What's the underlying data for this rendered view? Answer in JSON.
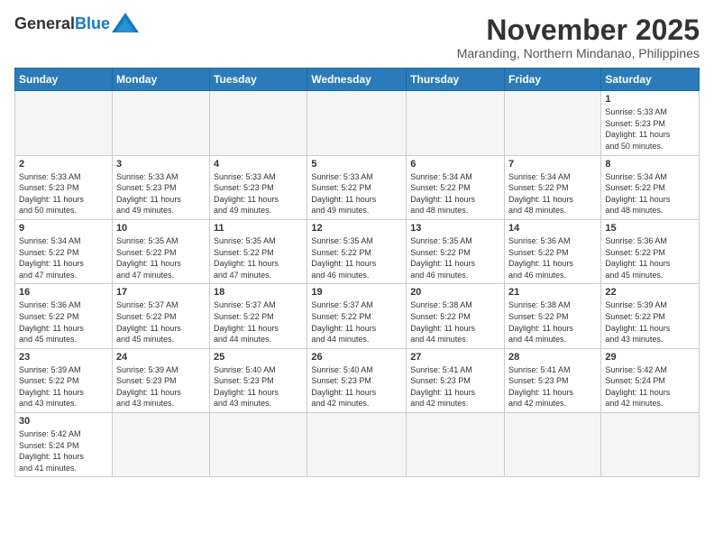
{
  "header": {
    "logo_general": "General",
    "logo_blue": "Blue",
    "month_title": "November 2025",
    "location": "Maranding, Northern Mindanao, Philippines"
  },
  "days_of_week": [
    "Sunday",
    "Monday",
    "Tuesday",
    "Wednesday",
    "Thursday",
    "Friday",
    "Saturday"
  ],
  "weeks": [
    [
      {
        "day": "",
        "info": ""
      },
      {
        "day": "",
        "info": ""
      },
      {
        "day": "",
        "info": ""
      },
      {
        "day": "",
        "info": ""
      },
      {
        "day": "",
        "info": ""
      },
      {
        "day": "",
        "info": ""
      },
      {
        "day": "1",
        "info": "Sunrise: 5:33 AM\nSunset: 5:23 PM\nDaylight: 11 hours\nand 50 minutes."
      }
    ],
    [
      {
        "day": "2",
        "info": "Sunrise: 5:33 AM\nSunset: 5:23 PM\nDaylight: 11 hours\nand 50 minutes."
      },
      {
        "day": "3",
        "info": "Sunrise: 5:33 AM\nSunset: 5:23 PM\nDaylight: 11 hours\nand 49 minutes."
      },
      {
        "day": "4",
        "info": "Sunrise: 5:33 AM\nSunset: 5:23 PM\nDaylight: 11 hours\nand 49 minutes."
      },
      {
        "day": "5",
        "info": "Sunrise: 5:33 AM\nSunset: 5:22 PM\nDaylight: 11 hours\nand 49 minutes."
      },
      {
        "day": "6",
        "info": "Sunrise: 5:34 AM\nSunset: 5:22 PM\nDaylight: 11 hours\nand 48 minutes."
      },
      {
        "day": "7",
        "info": "Sunrise: 5:34 AM\nSunset: 5:22 PM\nDaylight: 11 hours\nand 48 minutes."
      },
      {
        "day": "8",
        "info": "Sunrise: 5:34 AM\nSunset: 5:22 PM\nDaylight: 11 hours\nand 48 minutes."
      }
    ],
    [
      {
        "day": "9",
        "info": "Sunrise: 5:34 AM\nSunset: 5:22 PM\nDaylight: 11 hours\nand 47 minutes."
      },
      {
        "day": "10",
        "info": "Sunrise: 5:35 AM\nSunset: 5:22 PM\nDaylight: 11 hours\nand 47 minutes."
      },
      {
        "day": "11",
        "info": "Sunrise: 5:35 AM\nSunset: 5:22 PM\nDaylight: 11 hours\nand 47 minutes."
      },
      {
        "day": "12",
        "info": "Sunrise: 5:35 AM\nSunset: 5:22 PM\nDaylight: 11 hours\nand 46 minutes."
      },
      {
        "day": "13",
        "info": "Sunrise: 5:35 AM\nSunset: 5:22 PM\nDaylight: 11 hours\nand 46 minutes."
      },
      {
        "day": "14",
        "info": "Sunrise: 5:36 AM\nSunset: 5:22 PM\nDaylight: 11 hours\nand 46 minutes."
      },
      {
        "day": "15",
        "info": "Sunrise: 5:36 AM\nSunset: 5:22 PM\nDaylight: 11 hours\nand 45 minutes."
      }
    ],
    [
      {
        "day": "16",
        "info": "Sunrise: 5:36 AM\nSunset: 5:22 PM\nDaylight: 11 hours\nand 45 minutes."
      },
      {
        "day": "17",
        "info": "Sunrise: 5:37 AM\nSunset: 5:22 PM\nDaylight: 11 hours\nand 45 minutes."
      },
      {
        "day": "18",
        "info": "Sunrise: 5:37 AM\nSunset: 5:22 PM\nDaylight: 11 hours\nand 44 minutes."
      },
      {
        "day": "19",
        "info": "Sunrise: 5:37 AM\nSunset: 5:22 PM\nDaylight: 11 hours\nand 44 minutes."
      },
      {
        "day": "20",
        "info": "Sunrise: 5:38 AM\nSunset: 5:22 PM\nDaylight: 11 hours\nand 44 minutes."
      },
      {
        "day": "21",
        "info": "Sunrise: 5:38 AM\nSunset: 5:22 PM\nDaylight: 11 hours\nand 44 minutes."
      },
      {
        "day": "22",
        "info": "Sunrise: 5:39 AM\nSunset: 5:22 PM\nDaylight: 11 hours\nand 43 minutes."
      }
    ],
    [
      {
        "day": "23",
        "info": "Sunrise: 5:39 AM\nSunset: 5:22 PM\nDaylight: 11 hours\nand 43 minutes."
      },
      {
        "day": "24",
        "info": "Sunrise: 5:39 AM\nSunset: 5:23 PM\nDaylight: 11 hours\nand 43 minutes."
      },
      {
        "day": "25",
        "info": "Sunrise: 5:40 AM\nSunset: 5:23 PM\nDaylight: 11 hours\nand 43 minutes."
      },
      {
        "day": "26",
        "info": "Sunrise: 5:40 AM\nSunset: 5:23 PM\nDaylight: 11 hours\nand 42 minutes."
      },
      {
        "day": "27",
        "info": "Sunrise: 5:41 AM\nSunset: 5:23 PM\nDaylight: 11 hours\nand 42 minutes."
      },
      {
        "day": "28",
        "info": "Sunrise: 5:41 AM\nSunset: 5:23 PM\nDaylight: 11 hours\nand 42 minutes."
      },
      {
        "day": "29",
        "info": "Sunrise: 5:42 AM\nSunset: 5:24 PM\nDaylight: 11 hours\nand 42 minutes."
      }
    ],
    [
      {
        "day": "30",
        "info": "Sunrise: 5:42 AM\nSunset: 5:24 PM\nDaylight: 11 hours\nand 41 minutes."
      },
      {
        "day": "",
        "info": ""
      },
      {
        "day": "",
        "info": ""
      },
      {
        "day": "",
        "info": ""
      },
      {
        "day": "",
        "info": ""
      },
      {
        "day": "",
        "info": ""
      },
      {
        "day": "",
        "info": ""
      }
    ]
  ]
}
